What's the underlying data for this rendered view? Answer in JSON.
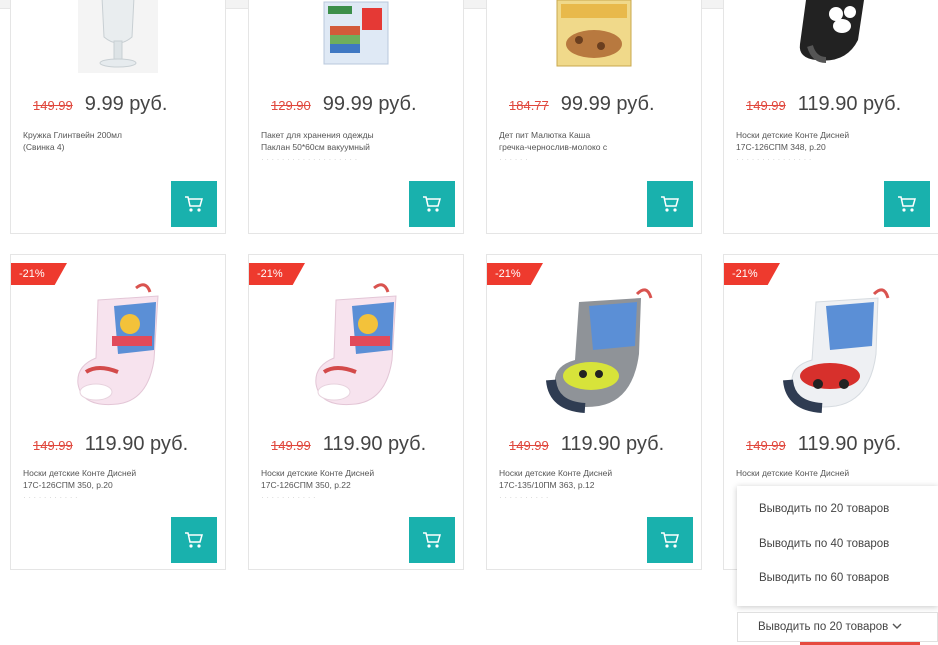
{
  "currency": "руб.",
  "products_row1": [
    {
      "old_price": "149.99",
      "price": "9.99 руб.",
      "title_l1": "Кружка Глинтвейн 200мл",
      "title_l2": "(Свинка 4)",
      "title_l3": ""
    },
    {
      "old_price": "129.90",
      "price": "99.99 руб.",
      "title_l1": "Пакет для хранения одежды",
      "title_l2": "Паклан 50*60см вакуумный",
      "title_l3": ""
    },
    {
      "old_price": "184.77",
      "price": "99.99 руб.",
      "title_l1": "Дет пит Малютка Каша",
      "title_l2": "гречка-чернослив-молоко с",
      "title_l3": ""
    },
    {
      "old_price": "149.99",
      "price": "119.90 руб.",
      "title_l1": "Носки детские Конте Дисней",
      "title_l2": "17С-126СПМ 348, р.20",
      "title_l3": ""
    }
  ],
  "products_row2": [
    {
      "badge": "-21%",
      "old_price": "149.99",
      "price": "119.90 руб.",
      "title_l1": "Носки детские Конте Дисней",
      "title_l2": "17С-126СПМ 350, р.20",
      "title_l3": ""
    },
    {
      "badge": "-21%",
      "old_price": "149.99",
      "price": "119.90 руб.",
      "title_l1": "Носки детские Конте Дисней",
      "title_l2": "17С-126СПМ 350, р.22",
      "title_l3": ""
    },
    {
      "badge": "-21%",
      "old_price": "149.99",
      "price": "119.90 руб.",
      "title_l1": "Носки детские Конте Дисней",
      "title_l2": "17С-135/10ПМ 363, р.12",
      "title_l3": ""
    },
    {
      "badge": "-21%",
      "old_price": "149.99",
      "price": "119.90 руб.",
      "title_l1": "Носки детские Конте Дисней",
      "title_l2": "",
      "title_l3": ""
    }
  ],
  "page_size": {
    "options": [
      "Выводить по 20 товаров",
      "Выводить по 40 товаров",
      "Выводить по 60 товаров"
    ],
    "selected": "Выводить по 20 товаров"
  },
  "colors": {
    "accent": "#19b1ad",
    "badge": "#ee3a2e",
    "old_price": "#e0483d"
  },
  "icons": {
    "cart": "cart-icon",
    "chevron": "chevron-down-icon"
  }
}
